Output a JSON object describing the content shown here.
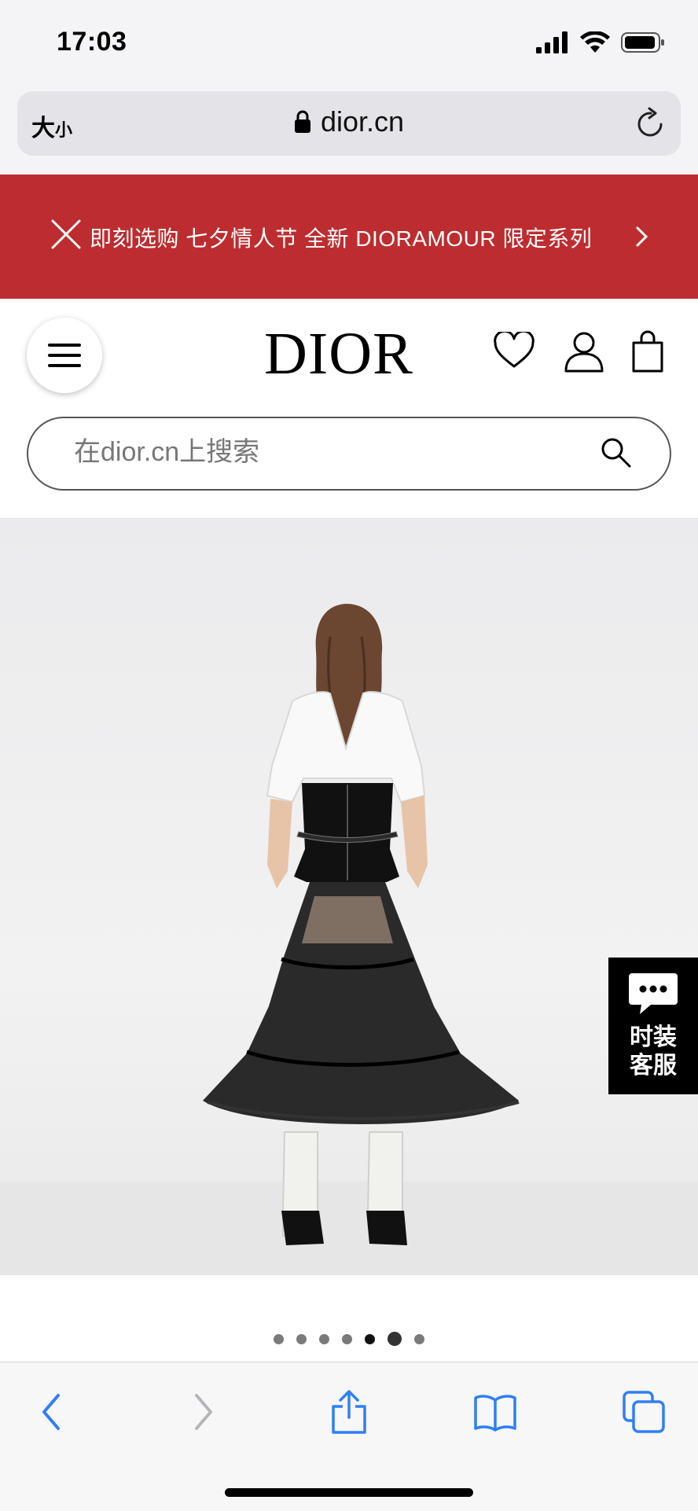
{
  "status_bar": {
    "time": "17:03",
    "icons": [
      "signal-icon",
      "wifi-icon",
      "battery-icon"
    ]
  },
  "address_bar": {
    "text_size_large": "大",
    "text_size_small": "小",
    "url": "dior.cn",
    "icons": [
      "lock-icon",
      "reload-icon"
    ]
  },
  "promo_banner": {
    "message": "即刻选购 七夕情人节 全新 DIORAMOUR 限定系列",
    "background_color": "#bd2d2f",
    "icons": [
      "close-icon",
      "chevron-right-icon"
    ]
  },
  "header": {
    "logo": "DIOR",
    "icons": [
      "hamburger-menu-icon",
      "heart-icon",
      "user-icon",
      "shopping-bag-icon"
    ]
  },
  "search": {
    "placeholder": "在dior.cn上搜索",
    "value": "",
    "icon": "search-icon"
  },
  "product_image": {
    "subject": "model-back-view-black-tulle-skirt"
  },
  "chat_widget": {
    "line1": "时装",
    "line2": "客服",
    "icon": "chat-bubble-icon"
  },
  "carousel": {
    "total": 7,
    "active_index": 5
  },
  "toolbar": {
    "icons": [
      "back-icon",
      "forward-icon",
      "share-icon",
      "bookmarks-icon",
      "tabs-icon"
    ],
    "accent_color": "#2f7ff6"
  }
}
